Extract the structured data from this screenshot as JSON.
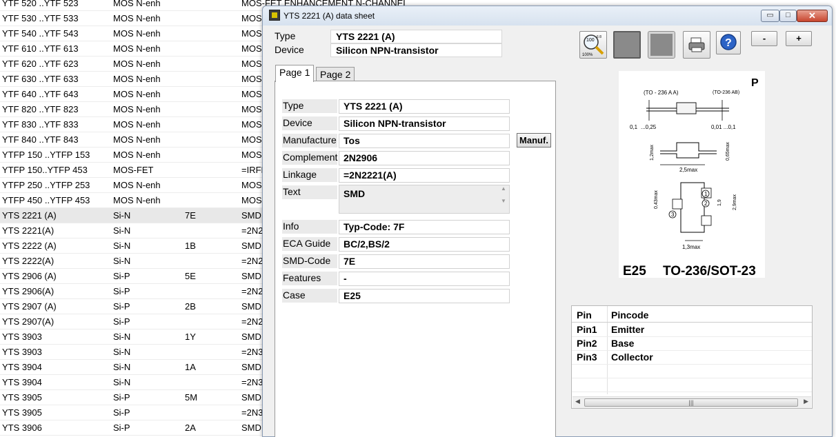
{
  "background_rows": [
    [
      "YTF 520  ..YTF 523",
      "MOS N-enh",
      "",
      "MOS-FET ENHANCEMENT N-CHANNEL"
    ],
    [
      "YTF 530  ..YTF 533",
      "MOS N-enh",
      "",
      "MOS-"
    ],
    [
      "YTF 540  ..YTF 543",
      "MOS N-enh",
      "",
      "MOS-"
    ],
    [
      "YTF 610  ..YTF 613",
      "MOS N-enh",
      "",
      "MOS-"
    ],
    [
      "YTF 620  ..YTF 623",
      "MOS N-enh",
      "",
      "MOS-"
    ],
    [
      "YTF 630  ..YTF 633",
      "MOS N-enh",
      "",
      "MOS-"
    ],
    [
      "YTF 640  ..YTF 643",
      "MOS N-enh",
      "",
      "MOS-"
    ],
    [
      "YTF 820  ..YTF 823",
      "MOS N-enh",
      "",
      "MOS-"
    ],
    [
      "YTF 830  ..YTF 833",
      "MOS N-enh",
      "",
      "MOS-"
    ],
    [
      "YTF 840  ..YTF 843",
      "MOS N-enh",
      "",
      "MOS-"
    ],
    [
      "YTFP 150  ..YTFP 153",
      "MOS N-enh",
      "",
      "MOS-"
    ],
    [
      "YTFP 150..YTFP 453",
      "MOS-FET",
      "",
      "=IRFF"
    ],
    [
      "YTFP 250  ..YTFP 253",
      "MOS N-enh",
      "",
      "MOS-"
    ],
    [
      "YTFP 450  ..YTFP 453",
      "MOS N-enh",
      "",
      "MOS-"
    ],
    [
      "YTS 2221 (A)",
      "Si-N",
      "7E",
      "SMD"
    ],
    [
      "YTS 2221(A)",
      "Si-N",
      "",
      "=2N2"
    ],
    [
      "YTS 2222 (A)",
      "Si-N",
      "1B",
      "SMD"
    ],
    [
      "YTS 2222(A)",
      "Si-N",
      "",
      "=2N2"
    ],
    [
      "YTS 2906 (A)",
      "Si-P",
      "5E",
      "SMD"
    ],
    [
      "YTS 2906(A)",
      "Si-P",
      "",
      "=2N2"
    ],
    [
      "YTS 2907 (A)",
      "Si-P",
      "2B",
      "SMD"
    ],
    [
      "YTS 2907(A)",
      "Si-P",
      "",
      "=2N2"
    ],
    [
      "YTS 3903",
      "Si-N",
      "1Y",
      "SMD"
    ],
    [
      "YTS 3903",
      "Si-N",
      "",
      "=2N3"
    ],
    [
      "YTS 3904",
      "Si-N",
      "1A",
      "SMD"
    ],
    [
      "YTS 3904",
      "Si-N",
      "",
      "=2N3"
    ],
    [
      "YTS 3905",
      "Si-P",
      "5M",
      "SMD"
    ],
    [
      "YTS 3905",
      "Si-P",
      "",
      "=2N3"
    ],
    [
      "YTS 3906",
      "Si-P",
      "2A",
      "SMD"
    ]
  ],
  "window": {
    "title": "YTS 2221 (A) data sheet",
    "min": "▭",
    "max": "□",
    "close": "✕"
  },
  "header": {
    "type_label": "Type",
    "type_value": "YTS 2221 (A)",
    "device_label": "Device",
    "device_value": "Silicon NPN-transistor"
  },
  "tabs": [
    "Page 1",
    "Page 2"
  ],
  "details": {
    "type_label": "Type",
    "type": "YTS 2221 (A)",
    "device_label": "Device",
    "device": "Silicon NPN-transistor",
    "manufacturer_label": "Manufacture",
    "manufacturer": "Tos",
    "complement_label": "Complement",
    "complement": "2N2906",
    "linkage_label": "Linkage",
    "linkage": "=2N2221(A)",
    "text_label": "Text",
    "text": "SMD",
    "info_label": "Info",
    "info": "Typ-Code: 7F",
    "eca_label": "ECA Guide",
    "eca": "BC/2,BS/2",
    "smd_label": "SMD-Code",
    "smd": "7E",
    "features_label": "Features",
    "features": "-",
    "case_label": "Case",
    "case": "E25"
  },
  "manuf_button": "Manuf.",
  "toolbar": {
    "zoom_top": "100",
    "zoom_mid": "6 8",
    "zoom_bottom": "100%",
    "minus": "-",
    "plus": "+"
  },
  "diagram": {
    "corner": "P",
    "label_left": "(TO - 236 A A)",
    "label_right": "(TO-236 AB)",
    "dim_a": "0,1",
    "dim_b": "...0,25",
    "dim_c": "0,01 ...0,1",
    "dim_d": "1,2max",
    "dim_e": "2,5max",
    "dim_f": "0,65max",
    "dim_g": "0,43max",
    "dim_h": "1,9",
    "dim_i": "2,9max",
    "dim_j": "1,3max",
    "pin1": "1",
    "pin2": "2",
    "pin3": "3",
    "case_code": "E25",
    "package": "TO-236/SOT-23"
  },
  "pins": {
    "col_pin": "Pin",
    "col_code": "Pincode",
    "rows": [
      [
        "Pin1",
        "Emitter"
      ],
      [
        "Pin2",
        "Base"
      ],
      [
        "Pin3",
        "Collector"
      ]
    ]
  }
}
